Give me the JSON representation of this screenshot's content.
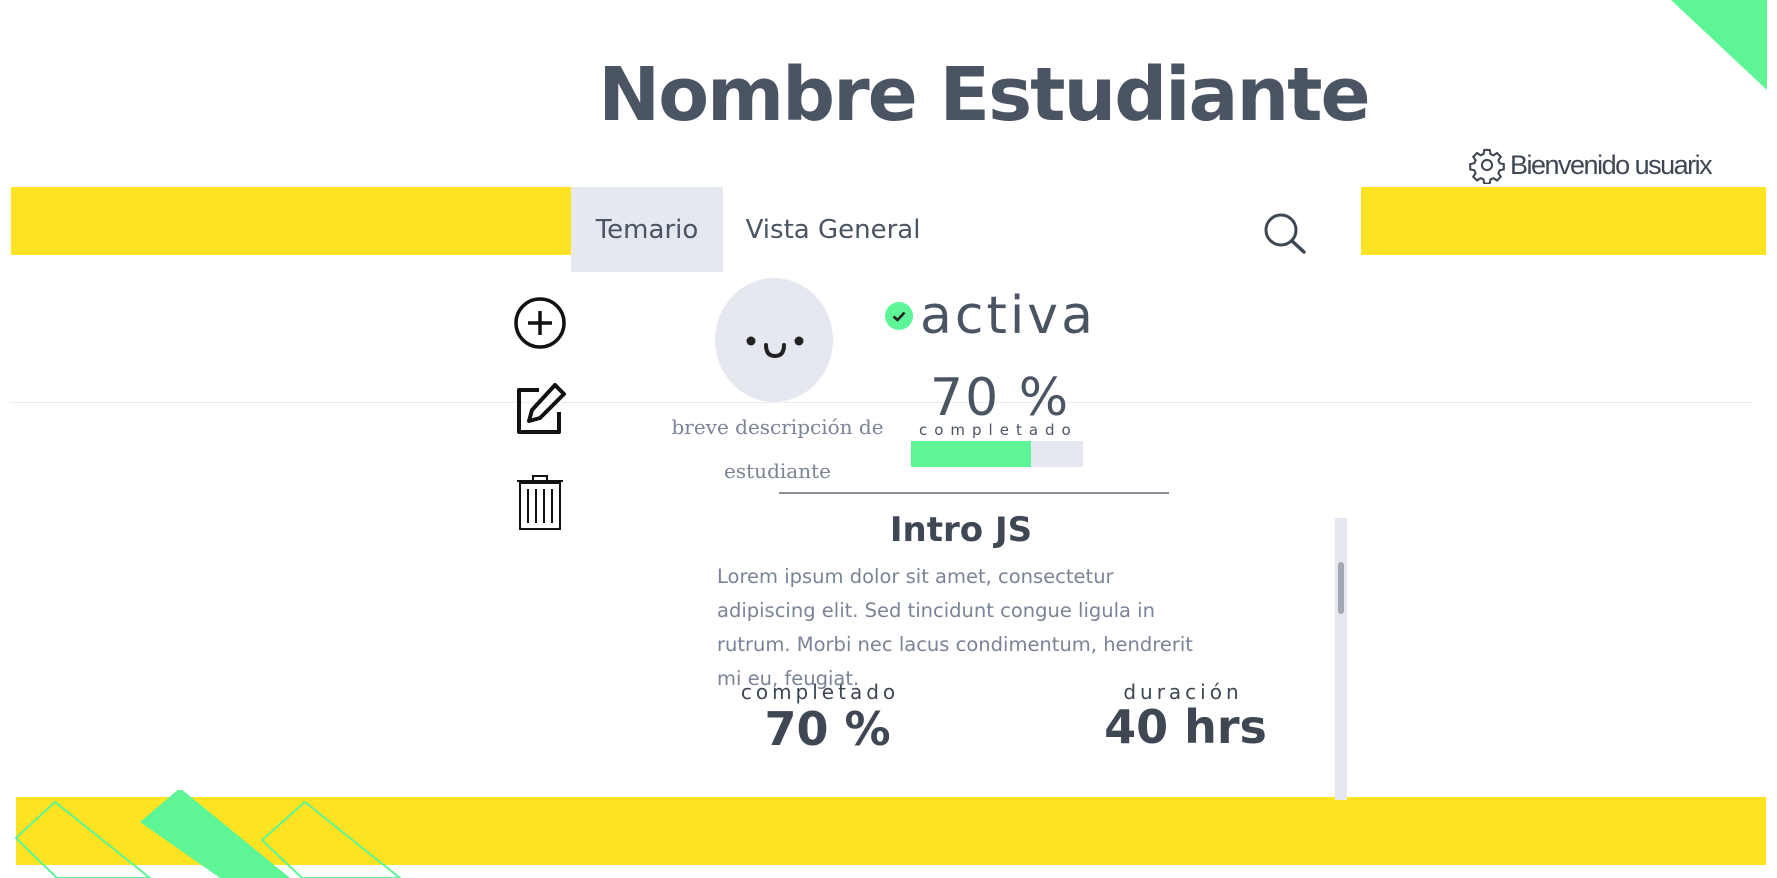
{
  "header": {
    "title": "Nombre Estudiante",
    "welcome_text": "Bienvenido usuarix"
  },
  "nav": {
    "tabs": [
      {
        "label": "Temario",
        "active": true
      },
      {
        "label": "Vista General",
        "active": false
      }
    ],
    "search_icon": "search-icon"
  },
  "tools": {
    "add_icon": "plus-circle-icon",
    "edit_icon": "edit-icon",
    "delete_icon": "trash-icon"
  },
  "student": {
    "avatar_icon": "smiley-face-icon",
    "description": "breve descripción de estudiante",
    "status": "activa",
    "progress_text": "70 %",
    "progress_caption": "completado",
    "progress_value": 0.7
  },
  "course": {
    "title": "Intro JS",
    "body": "Lorem ipsum dolor sit amet, consectetur adipiscing elit. Sed tincidunt congue ligula in rutrum. Morbi nec lacus condimentum, hendrerit mi eu, feugiat.",
    "completed_label": "completado",
    "completed_value": "70 %",
    "duration_label": "duración",
    "duration_value": "40 hrs"
  },
  "colors": {
    "yellow": "#fde321",
    "green": "#5ef596",
    "text_dark": "#4a5462",
    "muted": "#7a8496",
    "light_gray": "#e6e8ef"
  }
}
